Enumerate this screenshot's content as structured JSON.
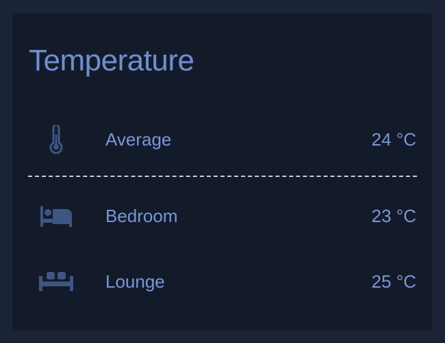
{
  "card": {
    "title": "Temperature",
    "rows": [
      {
        "icon": "thermometer-icon",
        "label": "Average",
        "value": "24 °C"
      },
      {
        "icon": "bed-icon",
        "label": "Bedroom",
        "value": "23 °C"
      },
      {
        "icon": "sofa-icon",
        "label": "Lounge",
        "value": "25 °C"
      }
    ]
  },
  "colors": {
    "background": "#1b2437",
    "card": "#131b2b",
    "title": "#6f8fcf",
    "text": "#7b96d4",
    "icon": "#3f5583",
    "divider": "#c9cfdc"
  }
}
